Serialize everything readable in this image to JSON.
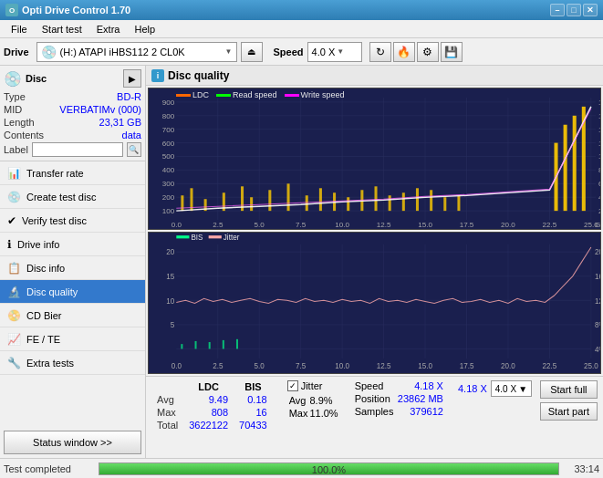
{
  "app": {
    "title": "Opti Drive Control 1.70",
    "icon": "O"
  },
  "titlebar": {
    "minimize": "–",
    "maximize": "□",
    "close": "✕"
  },
  "menu": {
    "items": [
      "File",
      "Start test",
      "Extra",
      "Help"
    ]
  },
  "drivebar": {
    "drive_label": "Drive",
    "drive_value": "(H:) ATAPI iHBS112  2 CL0K",
    "speed_label": "Speed",
    "speed_value": "4.0 X"
  },
  "disc": {
    "section_label": "Disc",
    "type_label": "Type",
    "type_value": "BD-R",
    "mid_label": "MID",
    "mid_value": "VERBATIMv (000)",
    "length_label": "Length",
    "length_value": "23,31 GB",
    "contents_label": "Contents",
    "contents_value": "data",
    "label_label": "Label"
  },
  "nav": {
    "items": [
      {
        "id": "transfer-rate",
        "label": "Transfer rate",
        "icon": "📊"
      },
      {
        "id": "create-test-disc",
        "label": "Create test disc",
        "icon": "💿"
      },
      {
        "id": "verify-test-disc",
        "label": "Verify test disc",
        "icon": "✔"
      },
      {
        "id": "drive-info",
        "label": "Drive info",
        "icon": "ℹ"
      },
      {
        "id": "disc-info",
        "label": "Disc info",
        "icon": "📋"
      },
      {
        "id": "disc-quality",
        "label": "Disc quality",
        "icon": "🔬",
        "active": true
      },
      {
        "id": "cd-bier",
        "label": "CD Bier",
        "icon": "📀"
      },
      {
        "id": "fe-te",
        "label": "FE / TE",
        "icon": "📈"
      },
      {
        "id": "extra-tests",
        "label": "Extra tests",
        "icon": "🔧"
      }
    ],
    "status_btn": "Status window >>"
  },
  "chart": {
    "title": "Disc quality",
    "icon": "i",
    "top_legend": [
      "LDC",
      "Read speed",
      "Write speed"
    ],
    "top_y_left": [
      "900",
      "800",
      "700",
      "600",
      "500",
      "400",
      "300",
      "200",
      "100"
    ],
    "top_y_right": [
      "18X",
      "16X",
      "14X",
      "12X",
      "10X",
      "8X",
      "6X",
      "4X",
      "2X"
    ],
    "top_x": [
      "0.0",
      "2.5",
      "5.0",
      "7.5",
      "10.0",
      "12.5",
      "15.0",
      "17.5",
      "20.0",
      "22.5",
      "25.0"
    ],
    "bottom_legend": [
      "BIS",
      "Jitter"
    ],
    "bottom_y_left": [
      "20",
      "15",
      "10",
      "5"
    ],
    "bottom_y_right": [
      "20%",
      "16%",
      "12%",
      "8%",
      "4%"
    ],
    "bottom_x": [
      "0.0",
      "2.5",
      "5.0",
      "7.5",
      "10.0",
      "12.5",
      "15.0",
      "17.5",
      "20.0",
      "22.5",
      "25.0"
    ]
  },
  "stats": {
    "col_headers": [
      "LDC",
      "BIS"
    ],
    "avg_label": "Avg",
    "avg_ldc": "9.49",
    "avg_bis": "0.18",
    "max_label": "Max",
    "max_ldc": "808",
    "max_bis": "16",
    "total_label": "Total",
    "total_ldc": "3622122",
    "total_bis": "70433",
    "jitter_label": "Jitter",
    "jitter_avg": "8.9%",
    "jitter_max": "11.0%",
    "speed_label": "Speed",
    "speed_value": "4.18 X",
    "speed_display": "4.0 X",
    "position_label": "Position",
    "position_value": "23862 MB",
    "samples_label": "Samples",
    "samples_value": "379612",
    "start_full": "Start full",
    "start_part": "Start part"
  },
  "statusbar": {
    "text": "Test completed",
    "progress": 100,
    "progress_text": "100.0%",
    "time": "33:14"
  }
}
